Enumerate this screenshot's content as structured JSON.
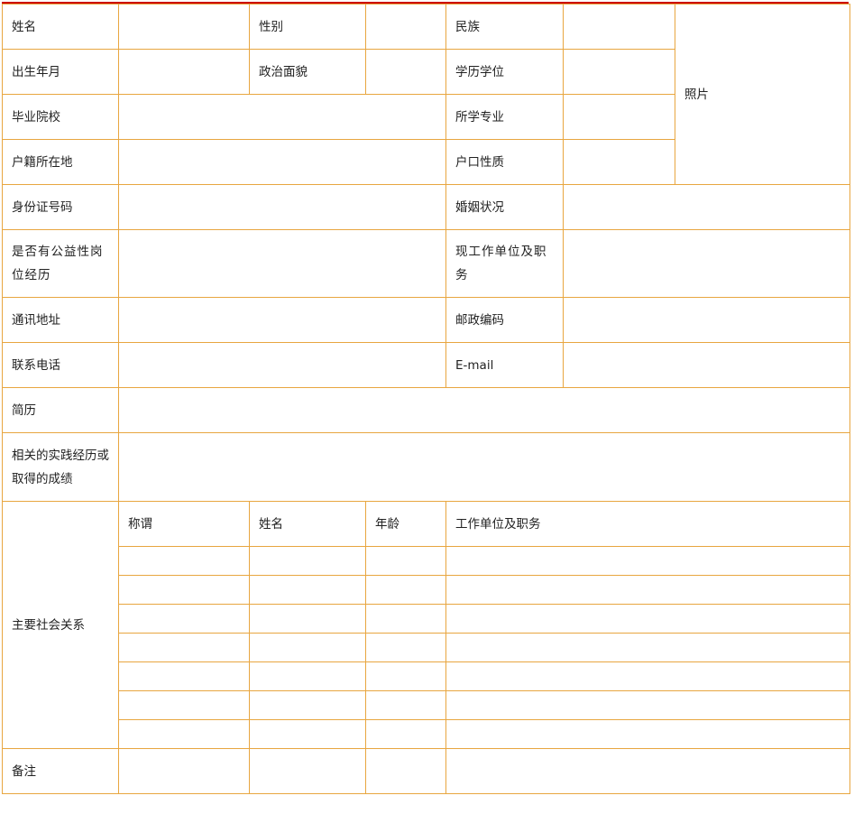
{
  "form": {
    "name_label": "姓名",
    "gender_label": "性别",
    "ethnicity_label": "民族",
    "photo_label": "照片",
    "birth_label": "出生年月",
    "political_label": "政治面貌",
    "degree_label": "学历学位",
    "school_label": "毕业院校",
    "major_label": "所学专业",
    "hukou_location_label": "户籍所在地",
    "hukou_type_label": "户口性质",
    "id_label": "身份证号码",
    "marital_label": "婚姻状况",
    "public_welfare_label": "是否有公益性岗位经历",
    "current_job_label": "现工作单位及职务",
    "address_label": "通讯地址",
    "postcode_label": "邮政编码",
    "phone_label": "联系电话",
    "email_label": "E-mail",
    "resume_label": "简历",
    "practice_label": "相关的实践经历或取得的成绩",
    "relations_label": "主要社会关系",
    "relations_headers": {
      "title": "称谓",
      "name": "姓名",
      "age": "年龄",
      "job": "工作单位及职务"
    },
    "relations_rows": 7,
    "remarks_label": "备注"
  }
}
